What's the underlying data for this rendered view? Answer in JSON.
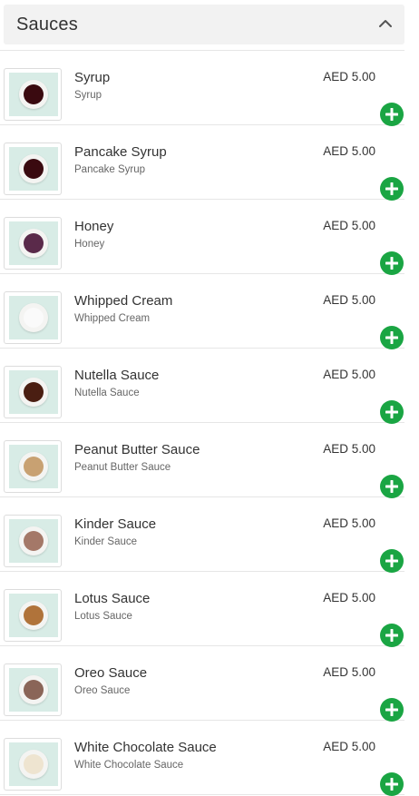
{
  "section": {
    "title": "Sauces",
    "icon": "chevron-up-icon"
  },
  "colors": {
    "accent": "#1aa543",
    "thumb_bg": "#d8ece6"
  },
  "items": [
    {
      "name": "Syrup",
      "description": "Syrup",
      "price": "AED 5.00",
      "sauce_color": "#3a0a10"
    },
    {
      "name": "Pancake Syrup",
      "description": "Pancake Syrup",
      "price": "AED 5.00",
      "sauce_color": "#3a0a10"
    },
    {
      "name": "Honey",
      "description": "Honey",
      "price": "AED 5.00",
      "sauce_color": "#5a2a4a"
    },
    {
      "name": "Whipped Cream",
      "description": "Whipped Cream",
      "price": "AED 5.00",
      "sauce_color": "#fafafa"
    },
    {
      "name": "Nutella Sauce",
      "description": "Nutella Sauce",
      "price": "AED 5.00",
      "sauce_color": "#4a1e12"
    },
    {
      "name": "Peanut Butter Sauce",
      "description": "Peanut Butter Sauce",
      "price": "AED 5.00",
      "sauce_color": "#c8a172"
    },
    {
      "name": "Kinder Sauce",
      "description": "Kinder Sauce",
      "price": "AED 5.00",
      "sauce_color": "#a47868"
    },
    {
      "name": "Lotus Sauce",
      "description": "Lotus Sauce",
      "price": "AED 5.00",
      "sauce_color": "#b0733a"
    },
    {
      "name": "Oreo Sauce",
      "description": "Oreo Sauce",
      "price": "AED 5.00",
      "sauce_color": "#8a6558"
    },
    {
      "name": "White Chocolate Sauce",
      "description": "White Chocolate Sauce",
      "price": "AED 5.00",
      "sauce_color": "#eee4d0"
    }
  ]
}
